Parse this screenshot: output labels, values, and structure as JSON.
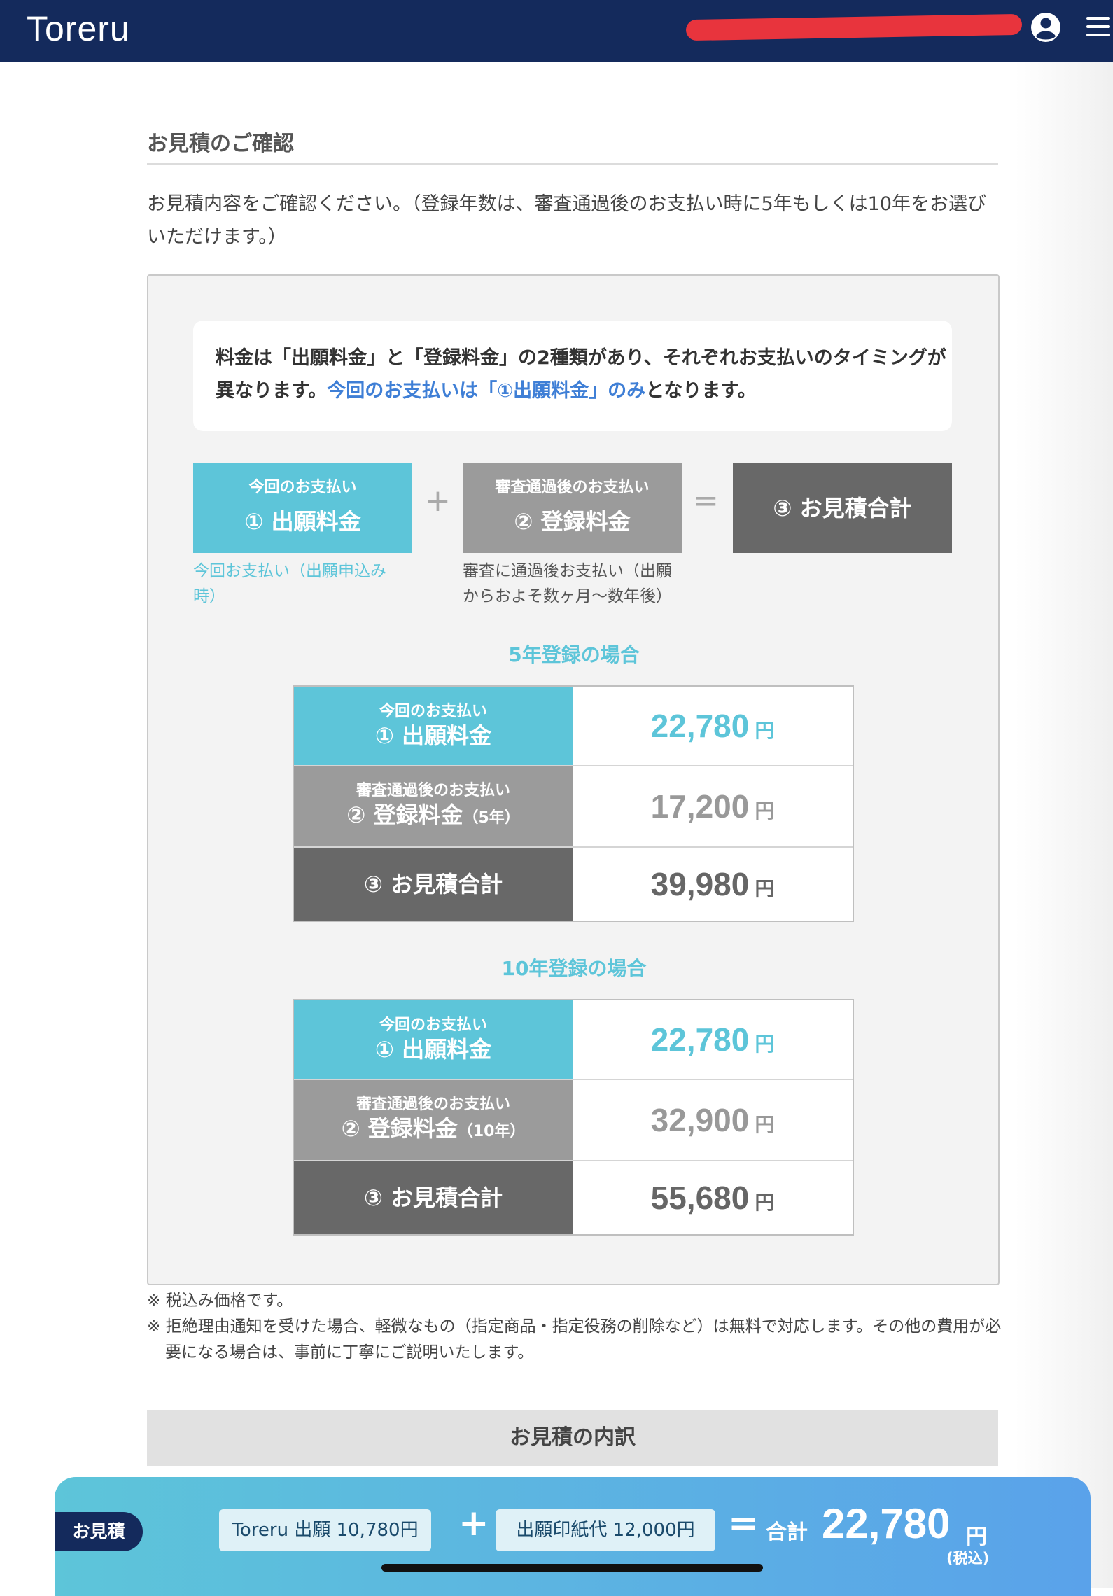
{
  "header": {
    "logo": "Toreru"
  },
  "section": {
    "title": "お見積のご確認",
    "intro": "お見積内容をご確認ください。（登録年数は、審査通過後のお支払い時に5年もしくは10年をお選びいただけます。）"
  },
  "notice": {
    "text_before": "料金は「出願料金」と「登録料金」の2種類があり、それぞれお支払いのタイミングが異なります。",
    "text_highlight": "今回のお支払いは「①出願料金」のみ",
    "text_after": "となります。"
  },
  "formula": {
    "box1_small": "今回のお支払い",
    "box1_big": "① 出願料金",
    "plus": "+",
    "box2_small": "審査通過後のお支払い",
    "box2_big": "② 登録料金",
    "equals": "=",
    "box3": "③ お見積合計",
    "note1": "今回お支払い（出願申込み時）",
    "note2": "審査に通過後お支払い（出願からおよそ数ヶ月〜数年後）"
  },
  "case5": {
    "title": "5年登録の場合",
    "row1_small": "今回のお支払い",
    "row1_big": "① 出願料金",
    "row1_value": "22,780",
    "row2_small": "審査通過後のお支払い",
    "row2_big": "② 登録料金",
    "row2_sub": "（5年）",
    "row2_value": "17,200",
    "row3_big": "③ お見積合計",
    "row3_value": "39,980",
    "unit": "円"
  },
  "case10": {
    "title": "10年登録の場合",
    "row1_small": "今回のお支払い",
    "row1_big": "① 出願料金",
    "row1_value": "22,780",
    "row2_small": "審査通過後のお支払い",
    "row2_big": "② 登録料金",
    "row2_sub": "（10年）",
    "row2_value": "32,900",
    "row3_big": "③ お見積合計",
    "row3_value": "55,680",
    "unit": "円"
  },
  "footnotes": {
    "note1": "※ 税込み価格です。",
    "note2": "※ 拒絶理由通知を受けた場合、軽微なもの（指定商品・指定役務の削除など）は無料で対応します。その他の費用が必要になる場合は、事前に丁寧にご説明いたします。"
  },
  "breakdown": {
    "title": "お見積の内訳"
  },
  "bottom_bar": {
    "label": "お見積",
    "item1": "Toreru 出願 10,780円",
    "plus": "+",
    "item2": "出願印紙代 12,000円",
    "equals": "=",
    "total_label": "合計",
    "total": "22,780",
    "unit": "円",
    "tax": "(税込)"
  },
  "colors": {
    "header": "#142a5c",
    "teal": "#5dc5d9",
    "gray": "#9b9b9b",
    "dark": "#686868",
    "highlight": "#3f7fd6"
  }
}
